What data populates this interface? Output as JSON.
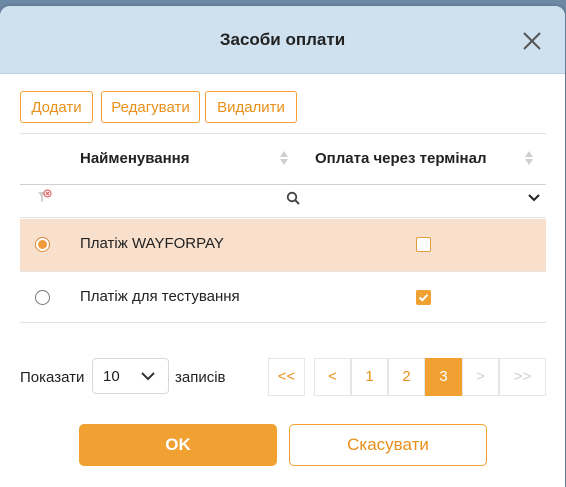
{
  "dialog": {
    "title": "Засоби оплати",
    "close_icon": "close-icon"
  },
  "toolbar": {
    "add_label": "Додати",
    "edit_label": "Редагувати",
    "delete_label": "Видалити"
  },
  "table": {
    "columns": [
      {
        "label": "Найменування",
        "sort_icon": "sort-icon"
      },
      {
        "label": "Оплата через термінал",
        "sort_icon": "sort-icon"
      }
    ],
    "filter": {
      "clear_icon": "filter-clear-icon",
      "search_icon": "search-icon",
      "dropdown_icon": "chevron-down-icon",
      "name_value": "",
      "terminal_value": ""
    },
    "rows": [
      {
        "name": "Платіж WAYFORPAY",
        "terminal": false,
        "selected": true
      },
      {
        "name": "Платіж для тестування",
        "terminal": true,
        "selected": false
      }
    ]
  },
  "pagination": {
    "show_label": "Показати",
    "page_size": "10",
    "records_label": "записів",
    "buttons": [
      {
        "label": "<<",
        "state": "normal"
      },
      {
        "label": "<",
        "state": "normal"
      },
      {
        "label": "1",
        "state": "normal"
      },
      {
        "label": "2",
        "state": "normal"
      },
      {
        "label": "3",
        "state": "active"
      },
      {
        "label": ">",
        "state": "disabled"
      },
      {
        "label": ">>",
        "state": "disabled"
      }
    ]
  },
  "footer": {
    "ok_label": "OK",
    "cancel_label": "Скасувати"
  },
  "colors": {
    "accent": "#f0a132",
    "header_bg": "#cfe0ee",
    "selected_row": "#f9e0cc"
  }
}
